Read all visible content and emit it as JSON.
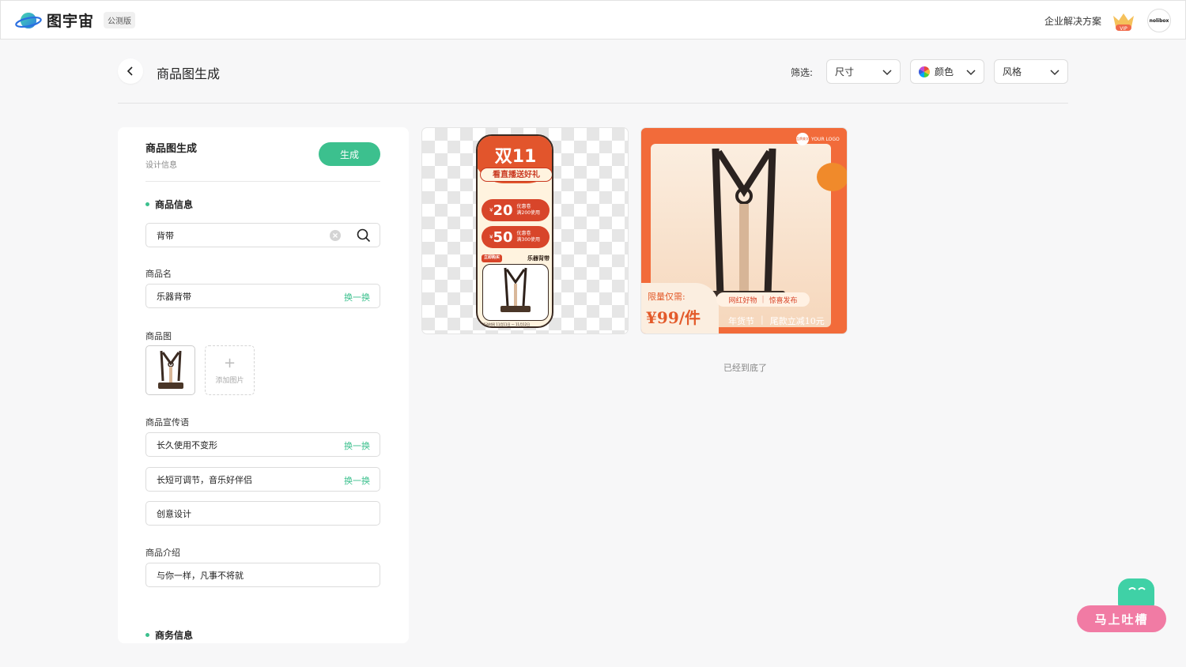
{
  "topbar": {
    "logo_name": "图宇宙",
    "beta_badge": "公测版",
    "enterprise_link": "企业解决方案",
    "vip_label": "VIP",
    "avatar_text": "nolibox"
  },
  "header": {
    "title": "商品图生成",
    "filter_label": "筛选:",
    "filters": [
      {
        "label": "尺寸",
        "icon": "chevron-down-icon"
      },
      {
        "label": "颜色",
        "icon": "color-wheel-icon"
      },
      {
        "label": "风格",
        "icon": "chevron-down-icon"
      }
    ]
  },
  "panel": {
    "title": "商品图生成",
    "subtitle": "设计信息",
    "generate_button": "生成",
    "product_info": {
      "heading": "商品信息",
      "search_value": "背带",
      "name_label": "商品名",
      "name_value": "乐器背带",
      "swap_label": "换一换",
      "image_label": "商品图",
      "add_image_label": "添加图片",
      "slogan_label": "商品宣传语",
      "slogans": [
        "长久使用不变形",
        "长短可调节，音乐好伴侣",
        "创意设计"
      ],
      "intro_label": "商品介绍",
      "intro_value": "与你一样，凡事不将就"
    },
    "business_info": {
      "heading": "商务信息"
    }
  },
  "results": {
    "end_text": "已经到底了",
    "poster1": {
      "title": "双11",
      "ribbon": "看直播送好礼",
      "coupons": [
        {
          "currency": "¥",
          "amount": "20",
          "label": "优惠卷",
          "condition": "满200使用"
        },
        {
          "currency": "¥",
          "amount": "50",
          "label": "优惠卷",
          "condition": "满300使用"
        }
      ],
      "tag": "立即购买",
      "product_name": "乐器背带",
      "footer": "活动时间 11月11日 — 11月12日"
    },
    "poster2": {
      "logo_circle": "品牌美学",
      "logo_text": "YOUR LOGO",
      "price_label": "限量仅需:",
      "price": "¥99/件",
      "tagline_left": "网红好物",
      "tagline_right": "惊喜发布",
      "bottom_left": "年货节",
      "bottom_right": "尾款立减10元"
    }
  },
  "feedback": {
    "label": "马上吐槽"
  },
  "colors": {
    "accent": "#3cc08e",
    "poster_red": "#e2552c",
    "feedback_pink": "#f17ba4"
  }
}
